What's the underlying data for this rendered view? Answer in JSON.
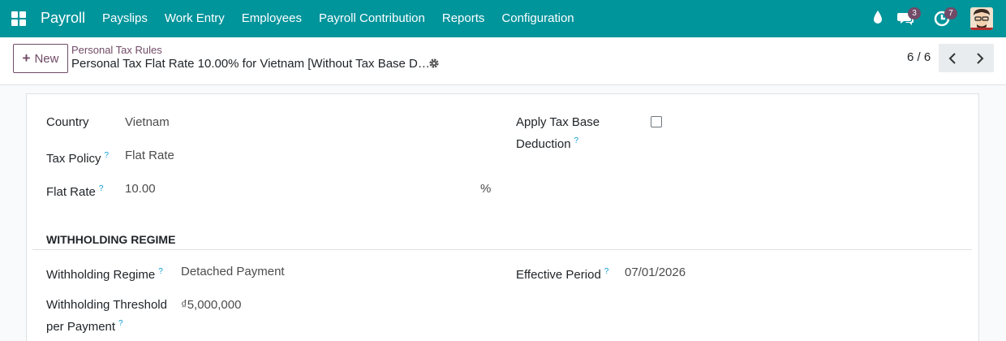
{
  "navbar": {
    "app_name": "Payroll",
    "menu": [
      "Payslips",
      "Work Entry",
      "Employees",
      "Payroll Contribution",
      "Reports",
      "Configuration"
    ],
    "messages_count": "3",
    "activities_count": "7",
    "bg_color": "#00949b"
  },
  "control_panel": {
    "new_label": "New",
    "breadcrumb": "Personal Tax Rules",
    "record_title": "Personal Tax Flat Rate 10.00% for Vietnam [Without Tax Base D…",
    "pager": "6 / 6"
  },
  "form": {
    "country_label": "Country",
    "country_value": "Vietnam",
    "tax_policy_label": "Tax Policy",
    "tax_policy_value": "Flat Rate",
    "flat_rate_label": "Flat Rate",
    "flat_rate_value": "10.00",
    "flat_rate_unit": "%",
    "apply_deduction_label_1": "Apply Tax Base",
    "apply_deduction_label_2": "Deduction",
    "apply_deduction_checked": false,
    "help_mark": "?",
    "section_title": "Withholding Regime",
    "withholding_regime_label": "Withholding Regime",
    "withholding_regime_value": "Detached Payment",
    "effective_period_label": "Effective Period",
    "effective_period_value": "07/01/2026",
    "threshold_label_1": "Withholding Threshold",
    "threshold_label_2": "per Payment",
    "threshold_value": "₫5,000,000"
  }
}
